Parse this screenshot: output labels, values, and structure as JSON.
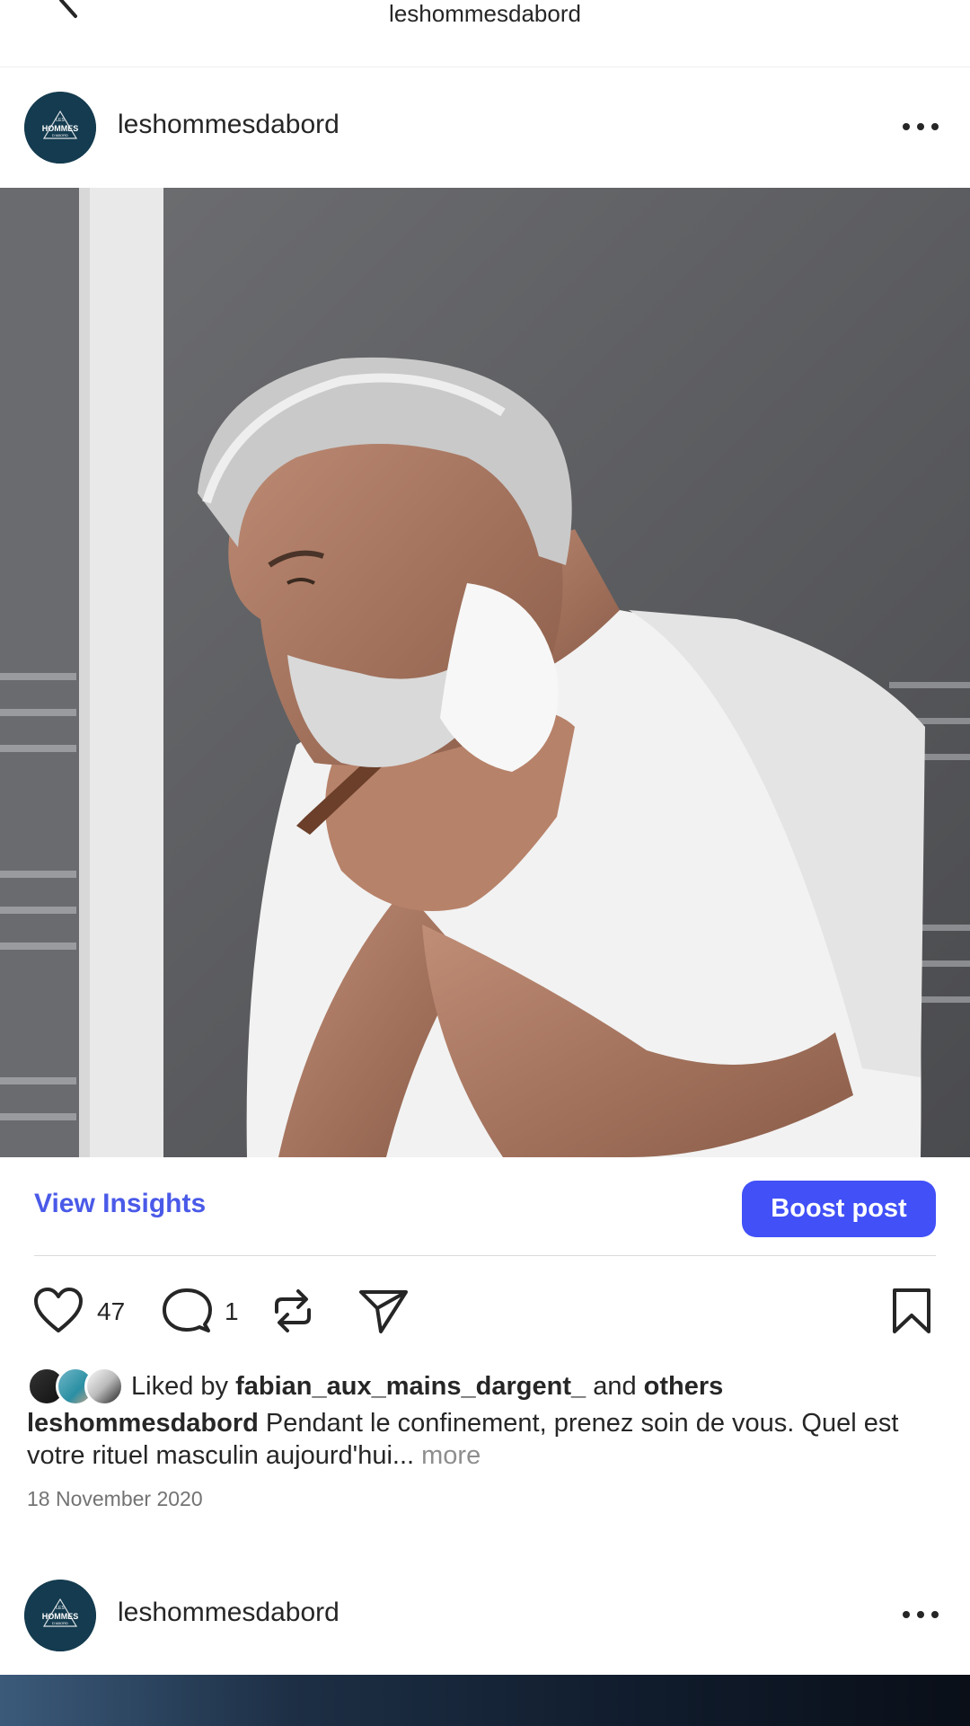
{
  "nav": {
    "title": "leshommesdabord"
  },
  "post": {
    "username": "leshommesdabord",
    "avatar_text": {
      "top": "LES",
      "main": "HOMMES",
      "bottom": "D'ABORD"
    },
    "view_insights": "View Insights",
    "boost_post": "Boost post",
    "likes_count": "47",
    "comments_count": "1",
    "liked_by_prefix": "Liked by",
    "liked_by_user": "fabian_aux_mains_dargent_",
    "liked_by_and": "and",
    "liked_by_others": "others",
    "caption_user": "leshommesdabord",
    "caption_text": "Pendant le confinement, prenez soin de vous. Quel est votre rituel masculin aujourd'hui...",
    "caption_more": "more",
    "date": "18 November 2020"
  },
  "next_post": {
    "username": "leshommesdabord",
    "avatar_text": {
      "top": "LES",
      "main": "HOMMES",
      "bottom": "D'ABORD"
    }
  },
  "colors": {
    "accent": "#4150f7",
    "link": "#4a5ae8",
    "avatar_bg": "#143b4f"
  },
  "icons": [
    "chevron-left-icon",
    "more-horizontal-icon",
    "heart-icon",
    "comment-icon",
    "repost-icon",
    "share-icon",
    "bookmark-icon"
  ]
}
